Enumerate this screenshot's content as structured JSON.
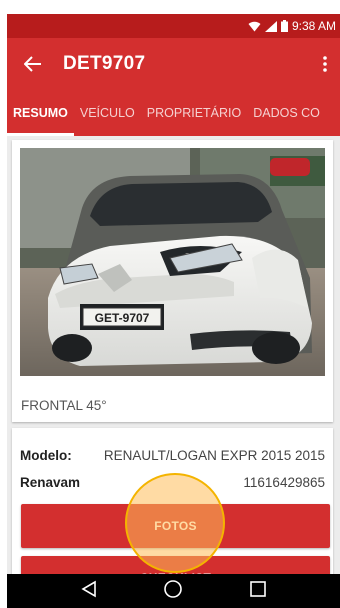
{
  "status": {
    "time": "9:38 AM",
    "icons": [
      "wifi-icon",
      "signal-icon",
      "battery-icon"
    ]
  },
  "appbar": {
    "title": "DET9707",
    "back_icon": "arrow-back-icon",
    "menu_icon": "more-vert-icon"
  },
  "tabs": [
    {
      "label": "RESUMO",
      "active": true
    },
    {
      "label": "VEÍCULO",
      "active": false
    },
    {
      "label": "PROPRIETÁRIO",
      "active": false
    },
    {
      "label": "DADOS CO",
      "active": false
    }
  ],
  "photo": {
    "plate": "GET-9707",
    "caption": "FRONTAL 45°"
  },
  "info": [
    {
      "key": "Modelo:",
      "value": "RENAULT/LOGAN EXPR 2015 2015"
    },
    {
      "key": "Renavam",
      "value": "11616429865"
    }
  ],
  "buttons": {
    "fotos": "FOTOS",
    "checklist": "CHECKLIST"
  },
  "colors": {
    "primary": "#d32f2f",
    "status_bar": "#b71c1c",
    "touch_highlight": "#f4b400"
  },
  "nav": {
    "icons": [
      "back-triangle-icon",
      "home-circle-icon",
      "recents-square-icon"
    ]
  }
}
